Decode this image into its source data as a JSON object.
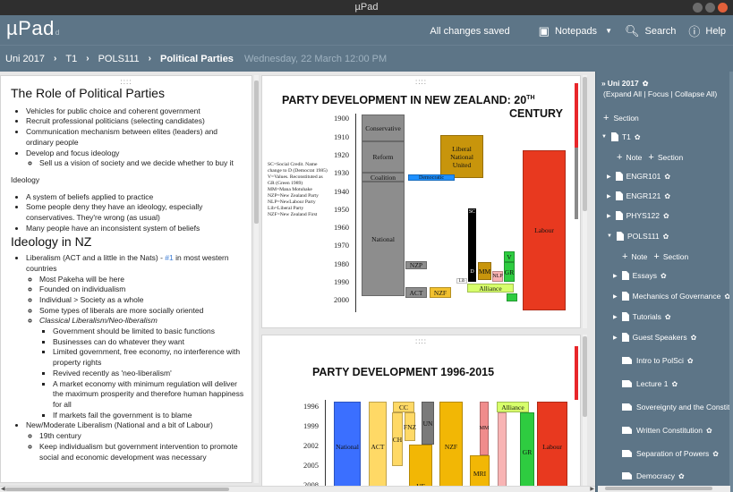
{
  "window": {
    "title": "µPad"
  },
  "header": {
    "brand": "µPad",
    "brand_sub": "d",
    "status": "All changes saved",
    "notepads_label": "Notepads",
    "search_label": "Search",
    "help_label": "Help"
  },
  "breadcrumb": {
    "items": [
      "Uni 2017",
      "T1",
      "POLS111",
      "Political Parties"
    ],
    "date": "Wednesday, 22 March 12:00 PM"
  },
  "note_text": {
    "heading1": "The Role of Political Parties",
    "roles": [
      "Vehicles for public choice and coherent government",
      "Recruit professional politicians (selecting candidates)",
      "Communication mechanism between elites (leaders) and ordinary people",
      "Develop and focus ideology"
    ],
    "roles_sub": "Sell us a vision of society and we decide whether to buy it",
    "ideology_label": "Ideology",
    "ideology_items": [
      "A system of beliefs applied to practice",
      "Some people deny they have an ideology, especially conservatives. They're wrong (as usual)",
      "Many people have an inconsistent system of beliefs"
    ],
    "heading2": "Ideology in NZ",
    "liberalism_text": "Liberalism (ACT and a little in the Nats) - ",
    "liberalism_ref": "#1",
    "liberalism_tail": " in most western countries",
    "liberalism_sub": [
      "Most Pakeha will be here",
      "Founded on individualism",
      "Individual > Society as a whole",
      "Some types of liberals are more socially oriented"
    ],
    "classical_label": "Classical Liberalism/Neo-liberalism",
    "classical_items": [
      "Government should be limited to basic functions",
      "Businesses can do whatever they want",
      "Limited government, free economy, no interference with property rights",
      "Revived recently as 'neo-liberalism'",
      "A market economy with minimum regulation will deliver the maximum prosperity and therefore human happiness for all",
      "If markets fail the government is to blame"
    ],
    "moderate_label": "New/Moderate Liberalism (National and a bit of Labour)",
    "moderate_items": [
      "19th century",
      "Keep individualism but government intervention to promote social and economic development was necessary"
    ]
  },
  "chart1": {
    "title_line1": "PARTY DEVELOPMENT IN NEW ZEALAND: 20",
    "title_sup": "TH",
    "title_line2": "CENTURY",
    "years": [
      "1900",
      "1910",
      "1920",
      "1930",
      "1940",
      "1950",
      "1960",
      "1970",
      "1980",
      "1990",
      "2000"
    ],
    "legend": [
      "SC=Social Credit. Name",
      "change to D (Democrat 1985)",
      "V=Values. Reconstituted as",
      "GR (Green 1989)",
      "MM=Mana Motuhake",
      "NZP=New Zealand Party",
      "NLP=NewLabour Party",
      "Lib=Liberal Party",
      "NZF=New Zealand First"
    ],
    "blocks": {
      "conservative": "Conservative",
      "reform": "Reform",
      "coalition": "Coalition",
      "national": "National",
      "liberal": "Liberal National United",
      "democratic": "Democratic",
      "labour": "Labour",
      "sc": "SC",
      "d": "D",
      "nzp": "NZP",
      "act": "ACT",
      "nzf": "NZF",
      "mm": "MM",
      "nlp": "NLP",
      "v": "V",
      "gr": "GR",
      "lib": "Lib",
      "alliance": "Alliance"
    }
  },
  "chart2": {
    "title": "PARTY DEVELOPMENT 1996-2015",
    "years": [
      "1996",
      "1999",
      "2002",
      "2005",
      "2008"
    ],
    "blocks": {
      "national": "National",
      "act": "ACT",
      "cc": "CC",
      "fnz": "FNZ",
      "ch": "CH",
      "uf": "UF",
      "un": "UN",
      "nzf": "NZF",
      "mm": "MM",
      "mri": "MRI",
      "alliance": "Alliance",
      "gr": "GR",
      "labour": "Labour"
    }
  },
  "sidebar": {
    "notepad": "Uni 2017",
    "controls": "(Expand All | Focus | Collapse All)",
    "add_section": "Section",
    "t1": "T1",
    "add_note": "Note",
    "add_section2": "Section",
    "engr101": "ENGR101",
    "engr121": "ENGR121",
    "phys122": "PHYS122",
    "pols111": "POLS111",
    "pols_add_note": "Note",
    "pols_add_section": "Section",
    "essays": "Essays",
    "mech": "Mechanics of Governance",
    "tutorials": "Tutorials",
    "guests": "Guest Speakers",
    "n_intro": "Intro to PolSci",
    "n_lecture1": "Lecture 1",
    "n_sovereignty": "Sovereignty and the Constitution",
    "n_written": "Written Constitution",
    "n_separation": "Separation of Powers",
    "n_democracy": "Democracy"
  }
}
